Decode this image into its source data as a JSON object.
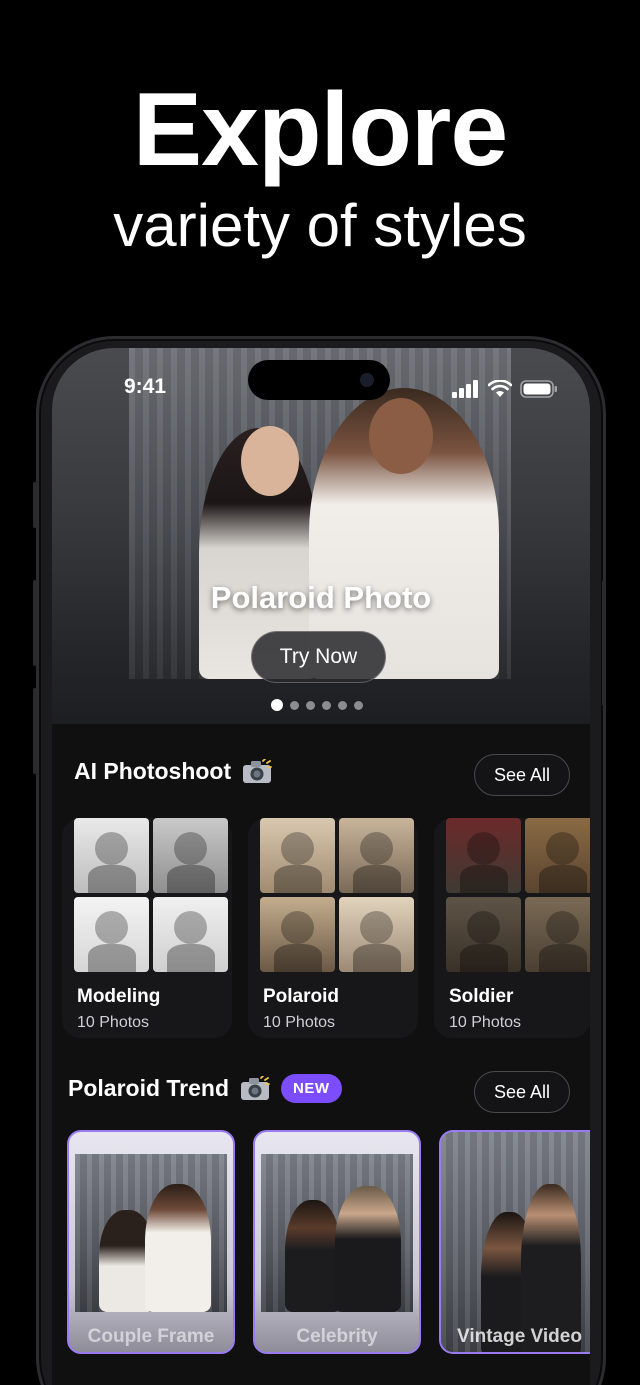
{
  "headline": "Explore",
  "subheadline": "variety of styles",
  "status_bar": {
    "time": "9:41"
  },
  "hero": {
    "title": "Polaroid Photo",
    "cta_label": "Try Now",
    "carousel": {
      "page_count": 6,
      "active_index": 0
    }
  },
  "ai_photoshoot": {
    "title": "AI Photoshoot",
    "see_all": "See All",
    "albums": [
      {
        "name": "Modeling",
        "count": "10 Photos"
      },
      {
        "name": "Polaroid",
        "count": "10 Photos"
      },
      {
        "name": "Soldier",
        "count": "10 Photos"
      }
    ]
  },
  "polaroid_trend": {
    "title": "Polaroid Trend",
    "badge": "NEW",
    "see_all": "See All",
    "cards": [
      {
        "label": "Couple Frame"
      },
      {
        "label": "Celebrity"
      },
      {
        "label": "Vintage Video"
      }
    ]
  },
  "colors": {
    "accent": "#7c4dff",
    "background": "#000000",
    "surface": "#101011"
  }
}
